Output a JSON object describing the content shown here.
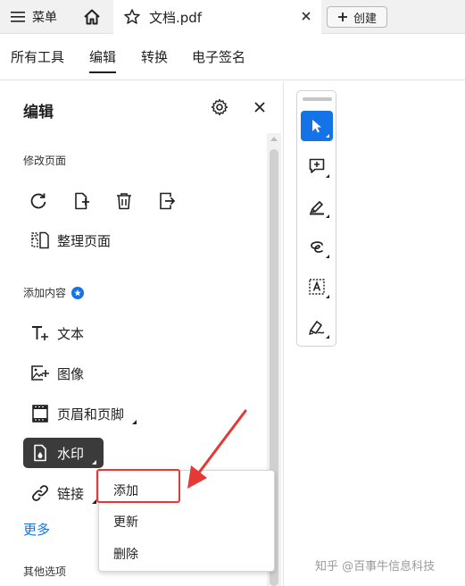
{
  "topbar": {
    "menu_label": "菜单",
    "doc_tab_title": "文档.pdf",
    "create_label": "创建"
  },
  "nav": {
    "items": [
      {
        "label": "所有工具"
      },
      {
        "label": "编辑"
      },
      {
        "label": "转换"
      },
      {
        "label": "电子签名"
      }
    ]
  },
  "panel": {
    "title": "编辑",
    "section_modify": "修改页面",
    "organize_label": "整理页面",
    "section_add": "添加内容",
    "items": [
      {
        "label": "文本",
        "icon": "add-text-icon"
      },
      {
        "label": "图像",
        "icon": "add-image-icon"
      },
      {
        "label": "页眉和页脚",
        "icon": "header-footer-icon"
      },
      {
        "label": "水印",
        "icon": "watermark-icon"
      },
      {
        "label": "链接",
        "icon": "link-icon"
      }
    ],
    "more_label": "更多",
    "section_other": "其他选项"
  },
  "dropdown": {
    "items": [
      {
        "label": "添加"
      },
      {
        "label": "更新"
      },
      {
        "label": "删除"
      }
    ]
  },
  "watermark_text": "知乎 @百事牛信息科技",
  "colors": {
    "accent": "#1473e6",
    "highlight": "#e53935",
    "selected_bg": "#3b3b3b"
  }
}
